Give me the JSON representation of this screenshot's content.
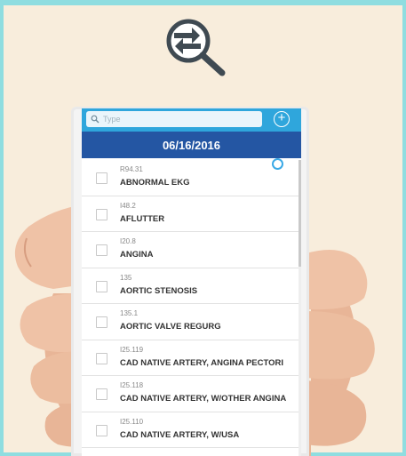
{
  "search": {
    "placeholder": "Type",
    "add_label": "+"
  },
  "date_header": "06/16/2016",
  "items": [
    {
      "code": "R94.31",
      "label": "ABNORMAL EKG"
    },
    {
      "code": "I48.2",
      "label": "AFLUTTER"
    },
    {
      "code": "I20.8",
      "label": "ANGINA"
    },
    {
      "code": "135",
      "label": "AORTIC STENOSIS"
    },
    {
      "code": "135.1",
      "label": "AORTIC VALVE REGURG"
    },
    {
      "code": "I25.119",
      "label": "CAD NATIVE ARTERY, ANGINA PECTORI"
    },
    {
      "code": "I25.118",
      "label": "CAD NATIVE ARTERY, W/OTHER ANGINA"
    },
    {
      "code": "I25.110",
      "label": "CAD NATIVE ARTERY, W/USA"
    }
  ],
  "colors": {
    "frame": "#8fdde0",
    "search_bar": "#2fa6dc",
    "date_bar": "#2456a3",
    "background": "#f8eddc"
  },
  "icons": {
    "logo": "swap-magnifier-icon",
    "search": "search-icon",
    "add": "plus-circle-icon"
  }
}
